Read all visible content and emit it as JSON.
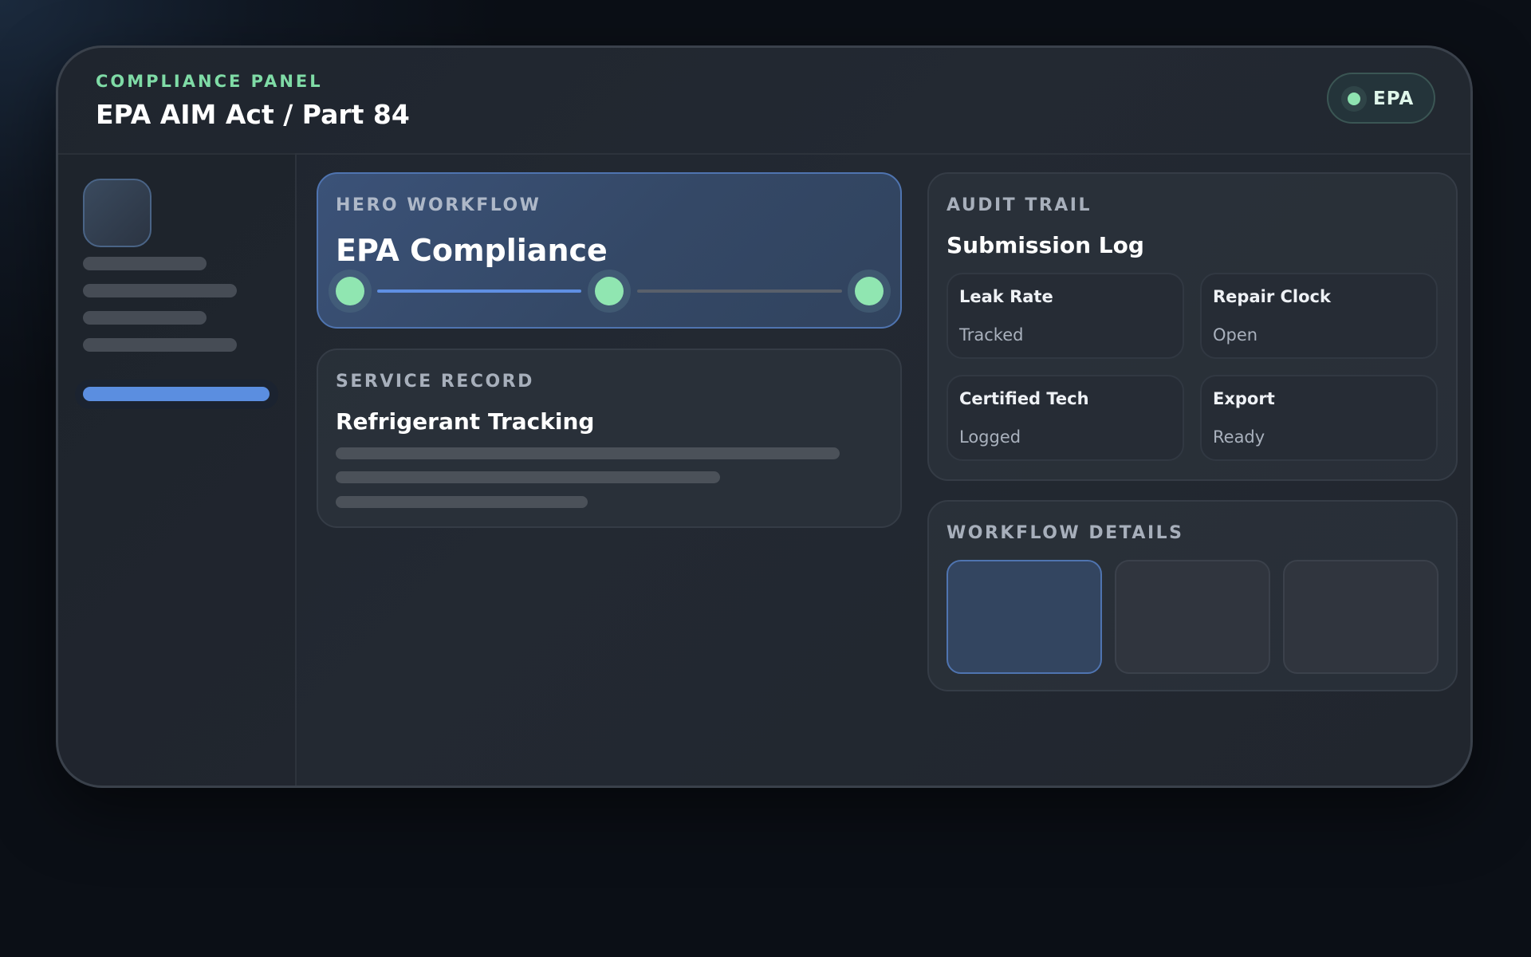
{
  "header": {
    "eyebrow": "COMPLIANCE PANEL",
    "title": "EPA AIM Act / Part 84",
    "badge": {
      "label": "EPA",
      "status_color": "#8ee3b0"
    }
  },
  "sidebar": {
    "active_index": 4,
    "accent_color": "#5b8ee0"
  },
  "hero_card": {
    "eyebrow": "HERO WORKFLOW",
    "title": "EPA Compliance",
    "steps_total": 3,
    "steps_completed_segments": 1
  },
  "service_card": {
    "eyebrow": "SERVICE RECORD",
    "title": "Refrigerant Tracking"
  },
  "audit_card": {
    "eyebrow": "AUDIT TRAIL",
    "title": "Submission Log",
    "tiles": [
      {
        "label": "Leak Rate",
        "value": "Tracked"
      },
      {
        "label": "Repair Clock",
        "value": "Open"
      },
      {
        "label": "Certified Tech",
        "value": "Logged"
      },
      {
        "label": "Export",
        "value": "Ready"
      }
    ]
  },
  "details_card": {
    "eyebrow": "WORKFLOW DETAILS",
    "selected_option": 0
  }
}
